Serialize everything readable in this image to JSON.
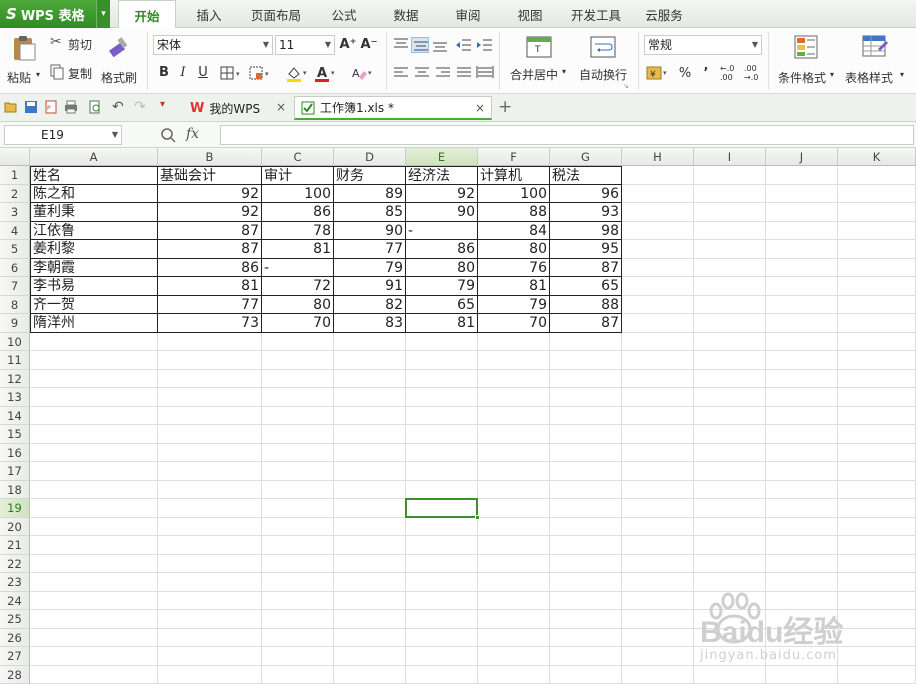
{
  "app": {
    "logo": "WPS 表格"
  },
  "menu": {
    "tabs": [
      "开始",
      "插入",
      "页面布局",
      "公式",
      "数据",
      "审阅",
      "视图",
      "开发工具",
      "云服务"
    ],
    "active_index": 0
  },
  "ribbon": {
    "paste": "粘贴",
    "cut": "剪切",
    "copy": "复制",
    "format_painter": "格式刷",
    "font_name": "宋体",
    "font_size": "11",
    "merge_center": "合并居中",
    "wrap_text": "自动换行",
    "number_format": "常规",
    "conditional_format": "条件格式",
    "table_style": "表格样式",
    "bold": "B",
    "italic": "I",
    "underline": "U",
    "percent": "%",
    "comma": "’",
    "inc_decimal": "←.0\n.00",
    "dec_decimal": ".00\n→.0"
  },
  "doc_tabs": [
    {
      "label": "我的WPS",
      "active": false
    },
    {
      "label": "工作簿1.xls *",
      "active": true
    }
  ],
  "formula_bar": {
    "cell_ref": "E19",
    "fx": "fx",
    "content": ""
  },
  "sheet": {
    "columns": [
      "A",
      "B",
      "C",
      "D",
      "E",
      "F",
      "G",
      "H",
      "I",
      "J",
      "K"
    ],
    "rows": [
      "1",
      "2",
      "3",
      "4",
      "5",
      "6",
      "7",
      "8",
      "9",
      "10",
      "11",
      "12",
      "13",
      "14",
      "15",
      "16",
      "17",
      "18",
      "19",
      "20",
      "21",
      "22",
      "23",
      "24",
      "25",
      "26",
      "27",
      "28"
    ],
    "selected_cell": "E19",
    "headers": [
      "姓名",
      "基础会计",
      "审计",
      "财务",
      "经济法",
      "计算机",
      "税法"
    ],
    "data": [
      [
        "陈之和",
        "92",
        "100",
        "89",
        "92",
        "100",
        "96"
      ],
      [
        "董利秉",
        "92",
        "86",
        "85",
        "90",
        "88",
        "93"
      ],
      [
        "江依鲁",
        "87",
        "78",
        "90",
        "-",
        "84",
        "98"
      ],
      [
        "姜利黎",
        "87",
        "81",
        "77",
        "86",
        "80",
        "95"
      ],
      [
        "李朝霞",
        "86",
        "-",
        "79",
        "80",
        "76",
        "87"
      ],
      [
        "李书易",
        "81",
        "72",
        "91",
        "79",
        "81",
        "65"
      ],
      [
        "齐一贺",
        "77",
        "80",
        "82",
        "65",
        "79",
        "88"
      ],
      [
        "隋洋州",
        "73",
        "70",
        "83",
        "81",
        "70",
        "87"
      ]
    ]
  },
  "watermark": {
    "brand": "Baidu经验",
    "url": "jingyan.baidu.com"
  }
}
